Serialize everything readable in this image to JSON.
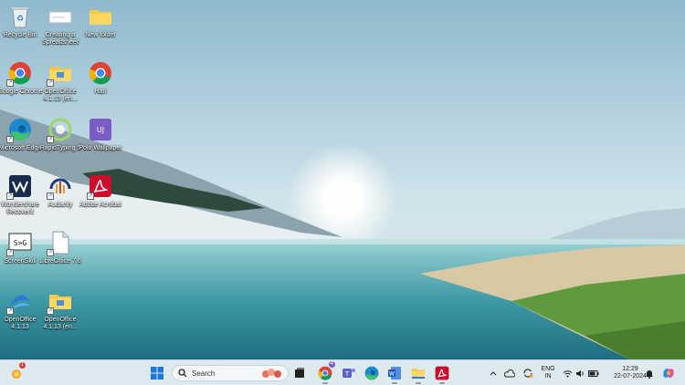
{
  "desktop": {
    "icons": [
      {
        "label": "Recycle Bin",
        "icon": "recycle-bin-icon"
      },
      {
        "label": "Creating a Spreadsheet",
        "icon": "document-icon"
      },
      {
        "label": "New folder",
        "icon": "folder-icon"
      },
      {
        "label": "Google Chrome",
        "icon": "chrome-icon"
      },
      {
        "label": "OpenOffice 4.1.13 (en...",
        "icon": "folder-icon"
      },
      {
        "label": "Hari",
        "icon": "chrome-icon"
      },
      {
        "label": "Microsoft Edge",
        "icon": "edge-icon"
      },
      {
        "label": "RapidTyping 5",
        "icon": "rapidtyping-icon"
      },
      {
        "label": "Polo Wallpaper",
        "icon": "wallpaper-app-icon"
      },
      {
        "label": "Wondershare Recoverit",
        "icon": "recoverit-icon"
      },
      {
        "label": "Audacity",
        "icon": "audacity-icon"
      },
      {
        "label": "Adobe Acrobat",
        "icon": "acrobat-icon"
      },
      {
        "label": "ScreenSkill",
        "icon": "screenskill-icon"
      },
      {
        "label": "LibreOffice 7.6",
        "icon": "libreoffice-icon"
      },
      {
        "label": "OpenOffice 4.1.13",
        "icon": "openoffice-icon"
      },
      {
        "label": "OpenOffice 4.1.13 (en...",
        "icon": "folder-icon"
      }
    ]
  },
  "taskbar": {
    "weather_badge": "1",
    "search_placeholder": "Search",
    "chrome_badge": "4",
    "tray": {
      "language": "ENG",
      "region": "IN",
      "time": "12:29",
      "date": "22-07-2024"
    }
  },
  "colors": {
    "taskbar_bg": "#dde8ef",
    "accent": "#1a73e8"
  }
}
